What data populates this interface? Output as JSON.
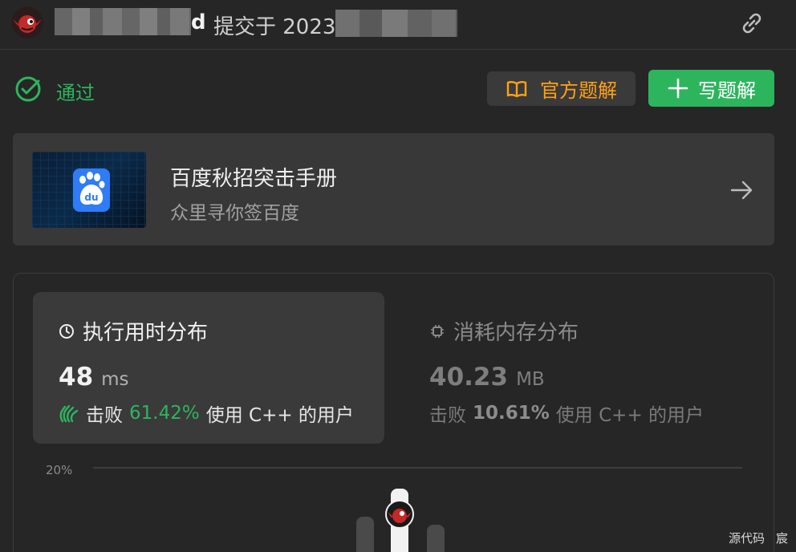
{
  "header": {
    "user_suffix": "d",
    "submitted_text": "提交于 2023"
  },
  "status": {
    "label": "通过",
    "color": "#2db55d"
  },
  "actions": {
    "official_label": "官方题解",
    "write_label": "写题解"
  },
  "promo": {
    "title": "百度秋招突击手册",
    "subtitle": "众里寻你签百度",
    "logo_text": "du"
  },
  "runtime": {
    "title": "执行用时分布",
    "value": "48",
    "unit": "ms",
    "beat_prefix": "击败",
    "beat_pct": "61.42%",
    "beat_suffix": "使用 C++ 的用户"
  },
  "memory": {
    "title": "消耗内存分布",
    "value": "40.23",
    "unit": "MB",
    "beat_prefix": "击败",
    "beat_pct": "10.61%",
    "beat_suffix": "使用 C++ 的用户"
  },
  "chart": {
    "y_tick": "20%"
  },
  "watermark": {
    "left": "源代码",
    "right": "宸"
  },
  "colors": {
    "accent_green": "#2db55d",
    "accent_orange": "#ffa116",
    "background": "#262626"
  }
}
